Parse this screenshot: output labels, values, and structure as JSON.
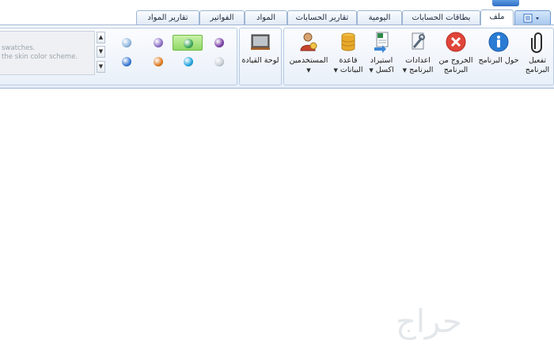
{
  "tabs": [
    {
      "label": "ملف",
      "active": true
    },
    {
      "label": "بطاقات الحسابات"
    },
    {
      "label": "اليومية"
    },
    {
      "label": "تقارير الحسابات"
    },
    {
      "label": "المواد"
    },
    {
      "label": "الفواتير"
    },
    {
      "label": "تقارير المواد"
    }
  ],
  "quick_menu_icon": "document-menu-icon",
  "ribbon": {
    "buttons": [
      {
        "label_line1": "تفعيل",
        "label_line2": "البرنامج",
        "icon": "paperclip-icon"
      },
      {
        "label_line1": "حول البرنامج",
        "label_line2": "",
        "icon": "info-icon"
      },
      {
        "label_line1": "الخروج من",
        "label_line2": "البرنامج",
        "icon": "exit-icon"
      },
      {
        "label_line1": "اعدادات",
        "label_line2": "البرنامج",
        "icon": "settings-tools-icon",
        "dropdown": true
      },
      {
        "label_line1": "استيراد",
        "label_line2": "اكسل",
        "icon": "excel-import-icon",
        "dropdown": true
      },
      {
        "label_line1": "قاعدة",
        "label_line2": "البيانات",
        "icon": "database-icon",
        "dropdown": true
      },
      {
        "label_line1": "المستخدمين",
        "label_line2": "",
        "icon": "users-icon",
        "dropdown": true
      },
      {
        "label_line1": "لوحة القيادة",
        "label_line2": "",
        "icon": "dashboard-icon"
      }
    ],
    "skin_gallery": {
      "text_line1": "swatches.",
      "text_line2": "the skin color scheme.",
      "swatch_colors": [
        "#7b3fa8",
        "#3da85a",
        "#8b6fc7",
        "#8fb8e0",
        "#c9d0d8",
        "#22a5e0",
        "#e07a1e",
        "#3a78d4"
      ],
      "selected_index": 1
    }
  },
  "colors": {
    "accent": "#2f6fc4",
    "tab_border": "#9eb5d2"
  },
  "watermark_text": "حراج"
}
